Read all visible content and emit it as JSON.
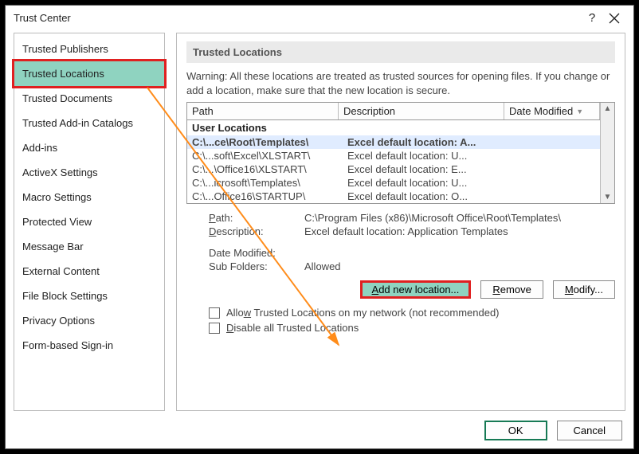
{
  "window": {
    "title": "Trust Center"
  },
  "sidebar": {
    "items": [
      {
        "label": "Trusted Publishers"
      },
      {
        "label": "Trusted Locations",
        "selected": true
      },
      {
        "label": "Trusted Documents"
      },
      {
        "label": "Trusted Add-in Catalogs"
      },
      {
        "label": "Add-ins"
      },
      {
        "label": "ActiveX Settings"
      },
      {
        "label": "Macro Settings"
      },
      {
        "label": "Protected View"
      },
      {
        "label": "Message Bar"
      },
      {
        "label": "External Content"
      },
      {
        "label": "File Block Settings"
      },
      {
        "label": "Privacy Options"
      },
      {
        "label": "Form-based Sign-in"
      }
    ]
  },
  "panel": {
    "title": "Trusted Locations",
    "warning": "Warning: All these locations are treated as trusted sources for opening files.  If you change or add a location, make sure that the new location is secure.",
    "columns": {
      "path": "Path",
      "desc": "Description",
      "date": "Date Modified"
    },
    "group_header": "User Locations",
    "rows": [
      {
        "path": "C:\\...ce\\Root\\Templates\\",
        "desc": "Excel default location: A...",
        "selected": true
      },
      {
        "path": "C:\\...soft\\Excel\\XLSTART\\",
        "desc": "Excel default location: U..."
      },
      {
        "path": "C:\\...\\Office16\\XLSTART\\",
        "desc": "Excel default location: E..."
      },
      {
        "path": "C:\\...icrosoft\\Templates\\",
        "desc": "Excel default location: U..."
      },
      {
        "path": "C:\\...Office16\\STARTUP\\",
        "desc": "Excel default location: O..."
      }
    ],
    "details": {
      "path_label": "Path:",
      "path_value": "C:\\Program Files (x86)\\Microsoft Office\\Root\\Templates\\",
      "desc_label": "Description:",
      "desc_value": "Excel default location: Application Templates",
      "date_label": "Date Modified:",
      "date_value": "",
      "sub_label": "Sub Folders:",
      "sub_value": "Allowed"
    },
    "buttons": {
      "add": "Add new location...",
      "remove": "Remove",
      "modify": "Modify..."
    },
    "checkboxes": {
      "allow_network": "Allow Trusted Locations on my network (not recommended)",
      "disable_all": "Disable all Trusted Locations"
    }
  },
  "footer": {
    "ok": "OK",
    "cancel": "Cancel"
  }
}
